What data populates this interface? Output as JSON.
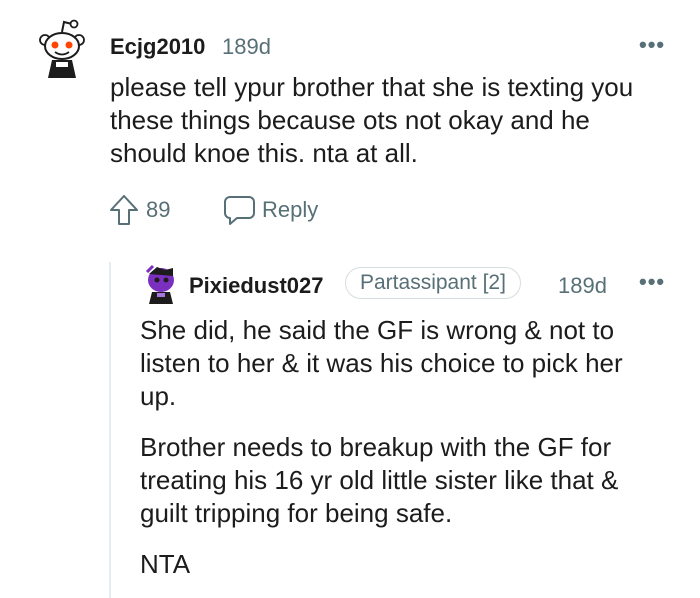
{
  "comment": {
    "username": "Ecjg2010",
    "time": "189d",
    "more_label": "•••",
    "lines": [
      "please tell ypur brother that she is texting you",
      "these things because ots not okay and he",
      "should knoe this. nta at all."
    ],
    "upvotes": "89",
    "reply_label": "Reply"
  },
  "reply": {
    "username": "Pixiedust027",
    "flair": "Partassipant [2]",
    "time": "189d",
    "more_label": "•••",
    "paragraphs": [
      [
        "She did, he said the GF is wrong & not to",
        "listen to her & it was his choice to pick her",
        "up."
      ],
      [
        "Brother needs to breakup with the GF for",
        "treating his 16 yr old little sister like that &",
        "guilt tripping for being safe."
      ],
      [
        "NTA"
      ]
    ]
  },
  "colors": {
    "text": "#1c1c1c",
    "meta": "#576f76",
    "thread_line": "#e5ebee",
    "avatar_eye": "#ff4500"
  },
  "icons": [
    "snoo-avatar-icon",
    "upvote-arrow-icon",
    "reply-bubble-icon",
    "purple-avatar-icon",
    "more-dots-icon"
  ]
}
